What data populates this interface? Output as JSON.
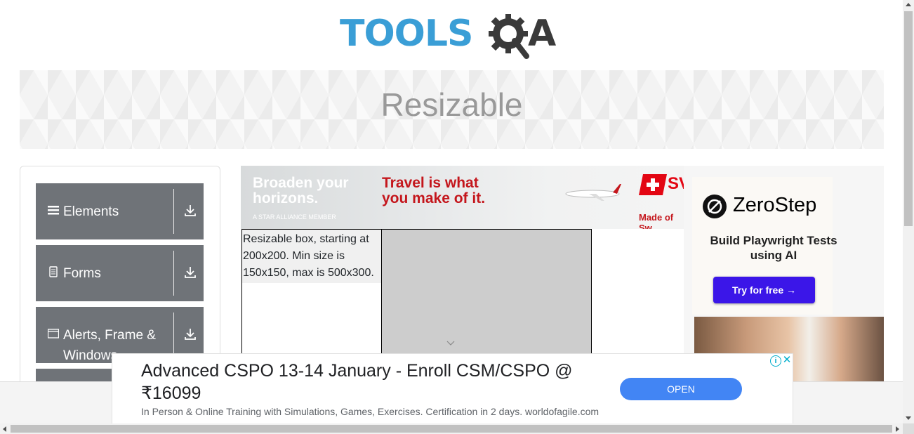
{
  "header": {
    "logo_part1": "TOOLS",
    "logo_part2": "A",
    "logo_icon": "gear-magnifier-icon"
  },
  "banner": {
    "title": "Resizable"
  },
  "sidebar": {
    "groups": [
      {
        "label": "Elements",
        "icon": "hamburger-icon"
      },
      {
        "label": "Forms",
        "icon": "document-icon"
      },
      {
        "label": "Alerts, Frame & Windows",
        "icon": "window-icon"
      }
    ],
    "download_icon": "download-icon"
  },
  "ad_travel": {
    "line1a": "Broaden your",
    "line1b": "horizons.",
    "member": "A STAR ALLIANCE MEMBER",
    "line2a": "Travel is what",
    "line2b": "you make of it.",
    "made": "Made of Sw",
    "brand_fragment": "SV"
  },
  "resizable": {
    "box_text": "Resizable box, starting at 200x200. Min size is 150x150, max is 500x300."
  },
  "ad_zerostep": {
    "brand": "ZeroStep",
    "tagline": "Build Playwright Tests using AI",
    "button": "Try for free →"
  },
  "ad_bottom": {
    "title": "Advanced CSPO 13-14 January - Enroll CSM/CSPO @ ₹16099",
    "description": "In Person & Online Training with Simulations, Games, Exercises. Certification in 2 days. worldofagile.com",
    "button": "OPEN",
    "info": "i",
    "close": "✕"
  },
  "colors": {
    "logo_blue": "#3a9ed6",
    "logo_dark": "#3a3a3a",
    "sidebar_bg": "#6f7378",
    "ad_red": "#c4161c",
    "zerostep_button": "#3b16e8",
    "open_button": "#4285f4"
  }
}
